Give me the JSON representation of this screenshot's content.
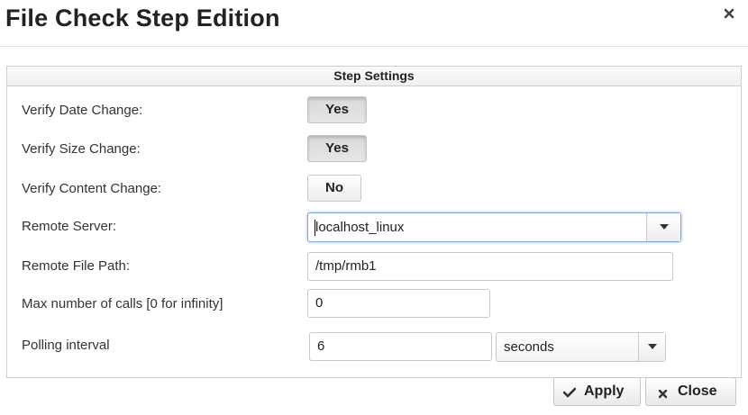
{
  "dialog": {
    "title": "File Check Step Edition"
  },
  "panel": {
    "title": "Step Settings"
  },
  "settings": {
    "verify_date_change": {
      "label": "Verify Date Change:",
      "value": "Yes"
    },
    "verify_size_change": {
      "label": "Verify Size Change:",
      "value": "Yes"
    },
    "verify_content_change": {
      "label": "Verify Content Change:",
      "value": "No"
    },
    "remote_server": {
      "label": "Remote Server:",
      "value": "localhost_linux"
    },
    "remote_file_path": {
      "label": "Remote File Path:",
      "value": "/tmp/rmb1"
    },
    "max_calls": {
      "label": "Max number of calls [0 for infinity]",
      "value": "0"
    },
    "polling_interval": {
      "label": "Polling interval",
      "value": "6",
      "unit": "seconds"
    }
  },
  "footer": {
    "apply_label": "Apply",
    "close_label": "Close"
  },
  "icons": {
    "close": "close-icon",
    "apply": "checkmark-icon",
    "cancel": "x-icon",
    "dropdown": "triangle-down-icon"
  }
}
